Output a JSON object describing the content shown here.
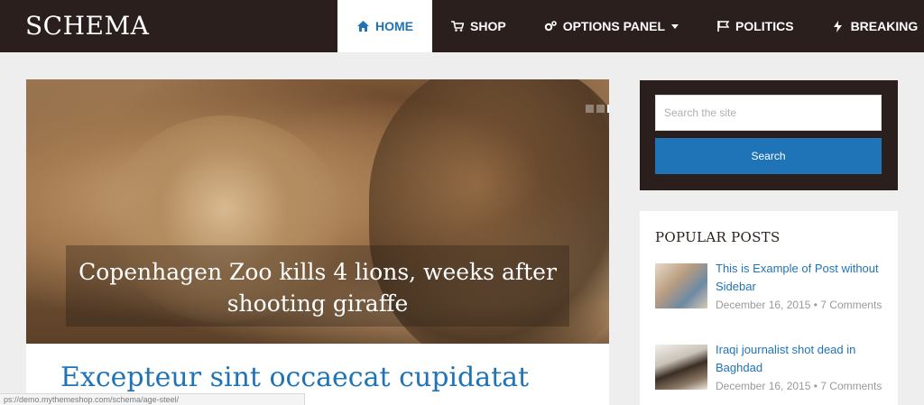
{
  "site": {
    "logo": "SCHEMA"
  },
  "nav": {
    "items": [
      {
        "label": "HOME",
        "icon": "home-icon",
        "active": true
      },
      {
        "label": "SHOP",
        "icon": "cart-icon"
      },
      {
        "label": "OPTIONS PANEL",
        "icon": "cogs-icon",
        "dropdown": true
      },
      {
        "label": "POLITICS",
        "icon": "flag-icon"
      },
      {
        "label": "BREAKING",
        "icon": "bolt-icon"
      }
    ]
  },
  "hero": {
    "caption": "Copenhagen Zoo kills 4 lions, weeks after shooting giraffe",
    "slides": 3,
    "active_slide": 3
  },
  "article": {
    "title": "Excepteur sint occaecat cupidatat"
  },
  "status": {
    "url": "ps://demo.mythemeshop.com/schema/age-steel/"
  },
  "search": {
    "placeholder": "Search the site",
    "button": "Search"
  },
  "popular": {
    "title": "POPULAR POSTS",
    "posts": [
      {
        "title": "This is Example of Post without Sidebar",
        "date": "December 16, 2015",
        "comments": "7 Comments"
      },
      {
        "title": "Iraqi journalist shot dead in Baghdad",
        "date": "December 16, 2015",
        "comments": "7 Comments"
      }
    ]
  },
  "colors": {
    "header_bg": "#2b1f1d",
    "accent": "#1f73b7",
    "page_bg": "#eeeeee"
  }
}
